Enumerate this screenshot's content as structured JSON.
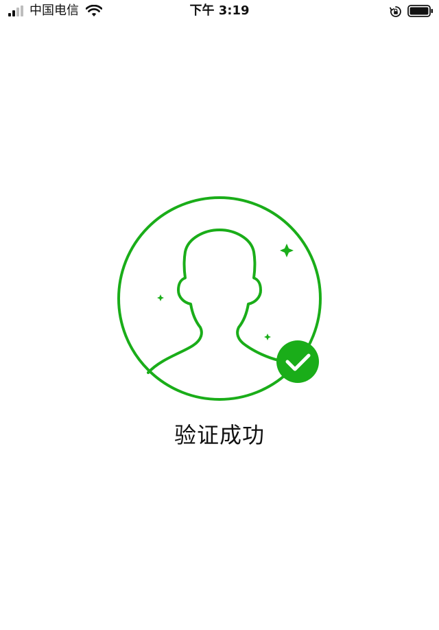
{
  "status_bar": {
    "carrier": "中国电信",
    "time": "下午 3:19",
    "icons": {
      "signal": "signal-strength-icon",
      "wifi": "wifi-icon",
      "rotation_lock": "rotation-lock-icon",
      "battery": "battery-icon"
    }
  },
  "main": {
    "message": "验证成功",
    "illustration_icon": "user-verified-icon",
    "badge_icon": "checkmark-icon"
  },
  "colors": {
    "accent": "#1aad19",
    "text": "#111111",
    "background": "#ffffff"
  }
}
